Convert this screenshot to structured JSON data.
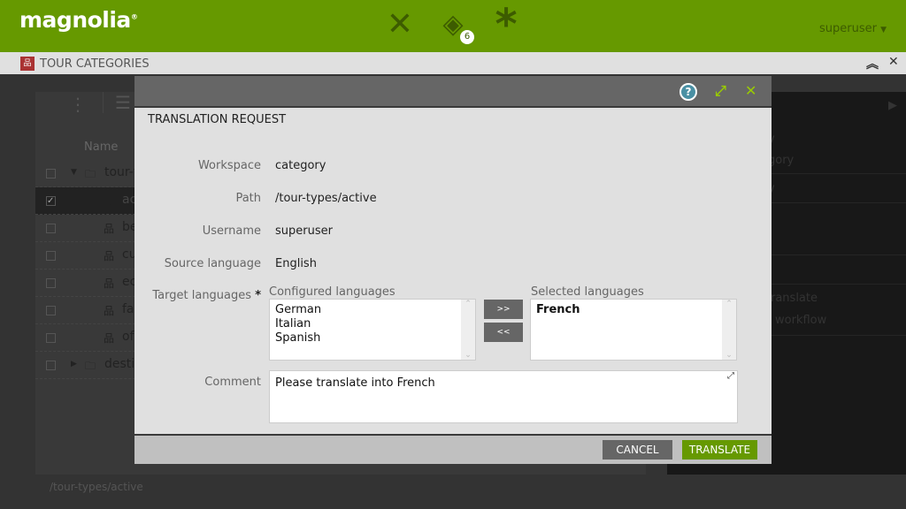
{
  "header": {
    "logo": "magnolia",
    "user": "superuser",
    "notification_count": "6",
    "brand_color": "#669900"
  },
  "appbar": {
    "title": "TOUR CATEGORIES"
  },
  "tree": {
    "column_name": "Name",
    "rows": [
      {
        "label": "tour-t",
        "type": "folder",
        "expanded": true,
        "checked": false
      },
      {
        "label": "ac",
        "type": "node",
        "checked": true
      },
      {
        "label": "be",
        "type": "node",
        "checked": false
      },
      {
        "label": "cu",
        "type": "node",
        "checked": false
      },
      {
        "label": "ec",
        "type": "node",
        "checked": false
      },
      {
        "label": "fa",
        "type": "node",
        "checked": false
      },
      {
        "label": "of",
        "type": "node",
        "checked": false
      },
      {
        "label": "destin",
        "type": "folder",
        "expanded": false,
        "checked": false
      }
    ]
  },
  "actions": {
    "items": [
      "y",
      "gory",
      "y",
      "ranslate",
      "workflow"
    ]
  },
  "status": {
    "path": "/tour-types/active"
  },
  "dialog": {
    "title": "TRANSLATION REQUEST",
    "fields": [
      {
        "label": "Workspace",
        "value": "category"
      },
      {
        "label": "Path",
        "value": "/tour-types/active"
      },
      {
        "label": "Username",
        "value": "superuser"
      },
      {
        "label": "Source language",
        "value": "English"
      }
    ],
    "target_label": "Target languages",
    "required_mark": "*",
    "configured_label": "Configured languages",
    "configured": [
      "German",
      "Italian",
      "Spanish"
    ],
    "selected_label": "Selected languages",
    "selected": [
      "French"
    ],
    "add_label": ">>",
    "remove_label": "<<",
    "comment_label": "Comment",
    "comment_value": "Please translate into French",
    "cancel": "CANCEL",
    "translate": "TRANSLATE"
  }
}
